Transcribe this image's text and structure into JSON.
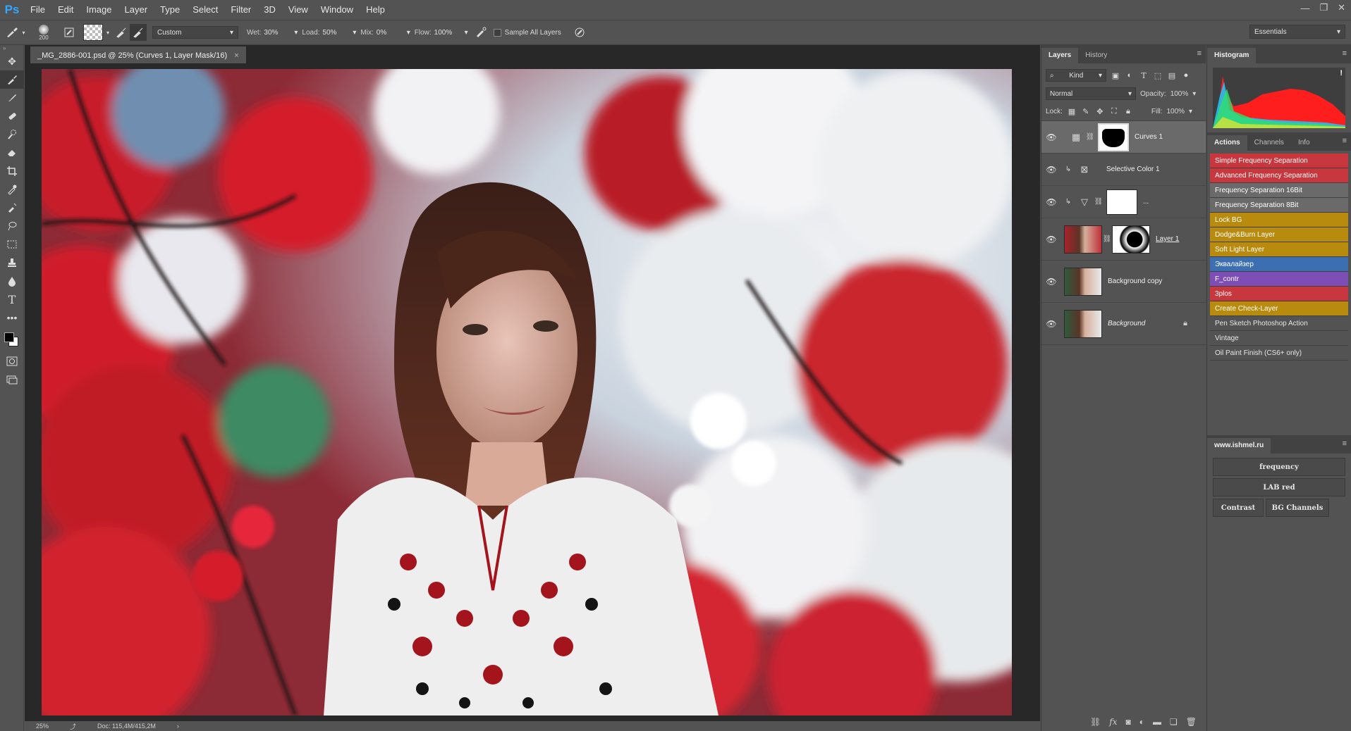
{
  "app": {
    "logo": "Ps",
    "window_controls": [
      "—",
      "❐",
      "✕"
    ]
  },
  "menu": [
    "File",
    "Edit",
    "Image",
    "Layer",
    "Type",
    "Select",
    "Filter",
    "3D",
    "View",
    "Window",
    "Help"
  ],
  "options": {
    "brush_size": "200",
    "preset": "Custom",
    "wet_label": "Wet:",
    "wet_value": "30%",
    "load_label": "Load:",
    "load_value": "50%",
    "mix_label": "Mix:",
    "mix_value": "0%",
    "flow_label": "Flow:",
    "flow_value": "100%",
    "sample_all_layers": "Sample All Layers",
    "workspace": "Essentials"
  },
  "document": {
    "tab_title": "_MG_2886-001.psd @ 25% (Curves 1, Layer Mask/16)",
    "tab_close": "×",
    "zoom": "25%",
    "doc_size": "Doc: 115,4M/415,2M",
    "status_arrow": "›"
  },
  "layers_panel": {
    "tabs": [
      "Layers",
      "History"
    ],
    "filter_kind": "Kind",
    "blend_mode": "Normal",
    "opacity_label": "Opacity:",
    "opacity_value": "100%",
    "lock_label": "Lock:",
    "fill_label": "Fill:",
    "fill_value": "100%",
    "layers": [
      {
        "name": "Curves 1",
        "selected": true
      },
      {
        "name": "Selective Color 1"
      },
      {
        "name": "..."
      },
      {
        "name": "Layer 1"
      },
      {
        "name": "Background copy"
      },
      {
        "name": "Background"
      }
    ]
  },
  "histogram_panel": {
    "tab": "Histogram",
    "warning": "!"
  },
  "actions_panel": {
    "tabs": [
      "Actions",
      "Channels",
      "Info"
    ],
    "items": [
      {
        "label": "Simple Frequency Separation",
        "color": "#c8373d"
      },
      {
        "label": "Advanced Frequency Separation",
        "color": "#c8373d"
      },
      {
        "label": "Frequency Separation 16Bit",
        "color": "#6a6a6a"
      },
      {
        "label": "Frequency Separation 8Bit",
        "color": "#6a6a6a"
      },
      {
        "label": "Lock BG",
        "color": "#b88a0d"
      },
      {
        "label": "Dodge&Burn Layer",
        "color": "#b88a0d"
      },
      {
        "label": "Soft Light Layer",
        "color": "#b88a0d"
      },
      {
        "label": "Эквалайзер",
        "color": "#3c6fb2"
      },
      {
        "label": "F_contr",
        "color": "#7d4fb5"
      },
      {
        "label": "3plos",
        "color": "#c8373d"
      },
      {
        "label": "Create Check-Layer",
        "color": "#b88a0d"
      },
      {
        "label": "Pen Sketch Photoshop Action",
        "color": ""
      },
      {
        "label": "Vintage",
        "color": ""
      },
      {
        "label": "Oil Paint Finish (CS6+ only)",
        "color": ""
      }
    ]
  },
  "plugin_panel": {
    "tab": "www.ishmel.ru",
    "buttons": [
      "frequency",
      "LAB red",
      "Contrast",
      "BG Channels"
    ]
  }
}
